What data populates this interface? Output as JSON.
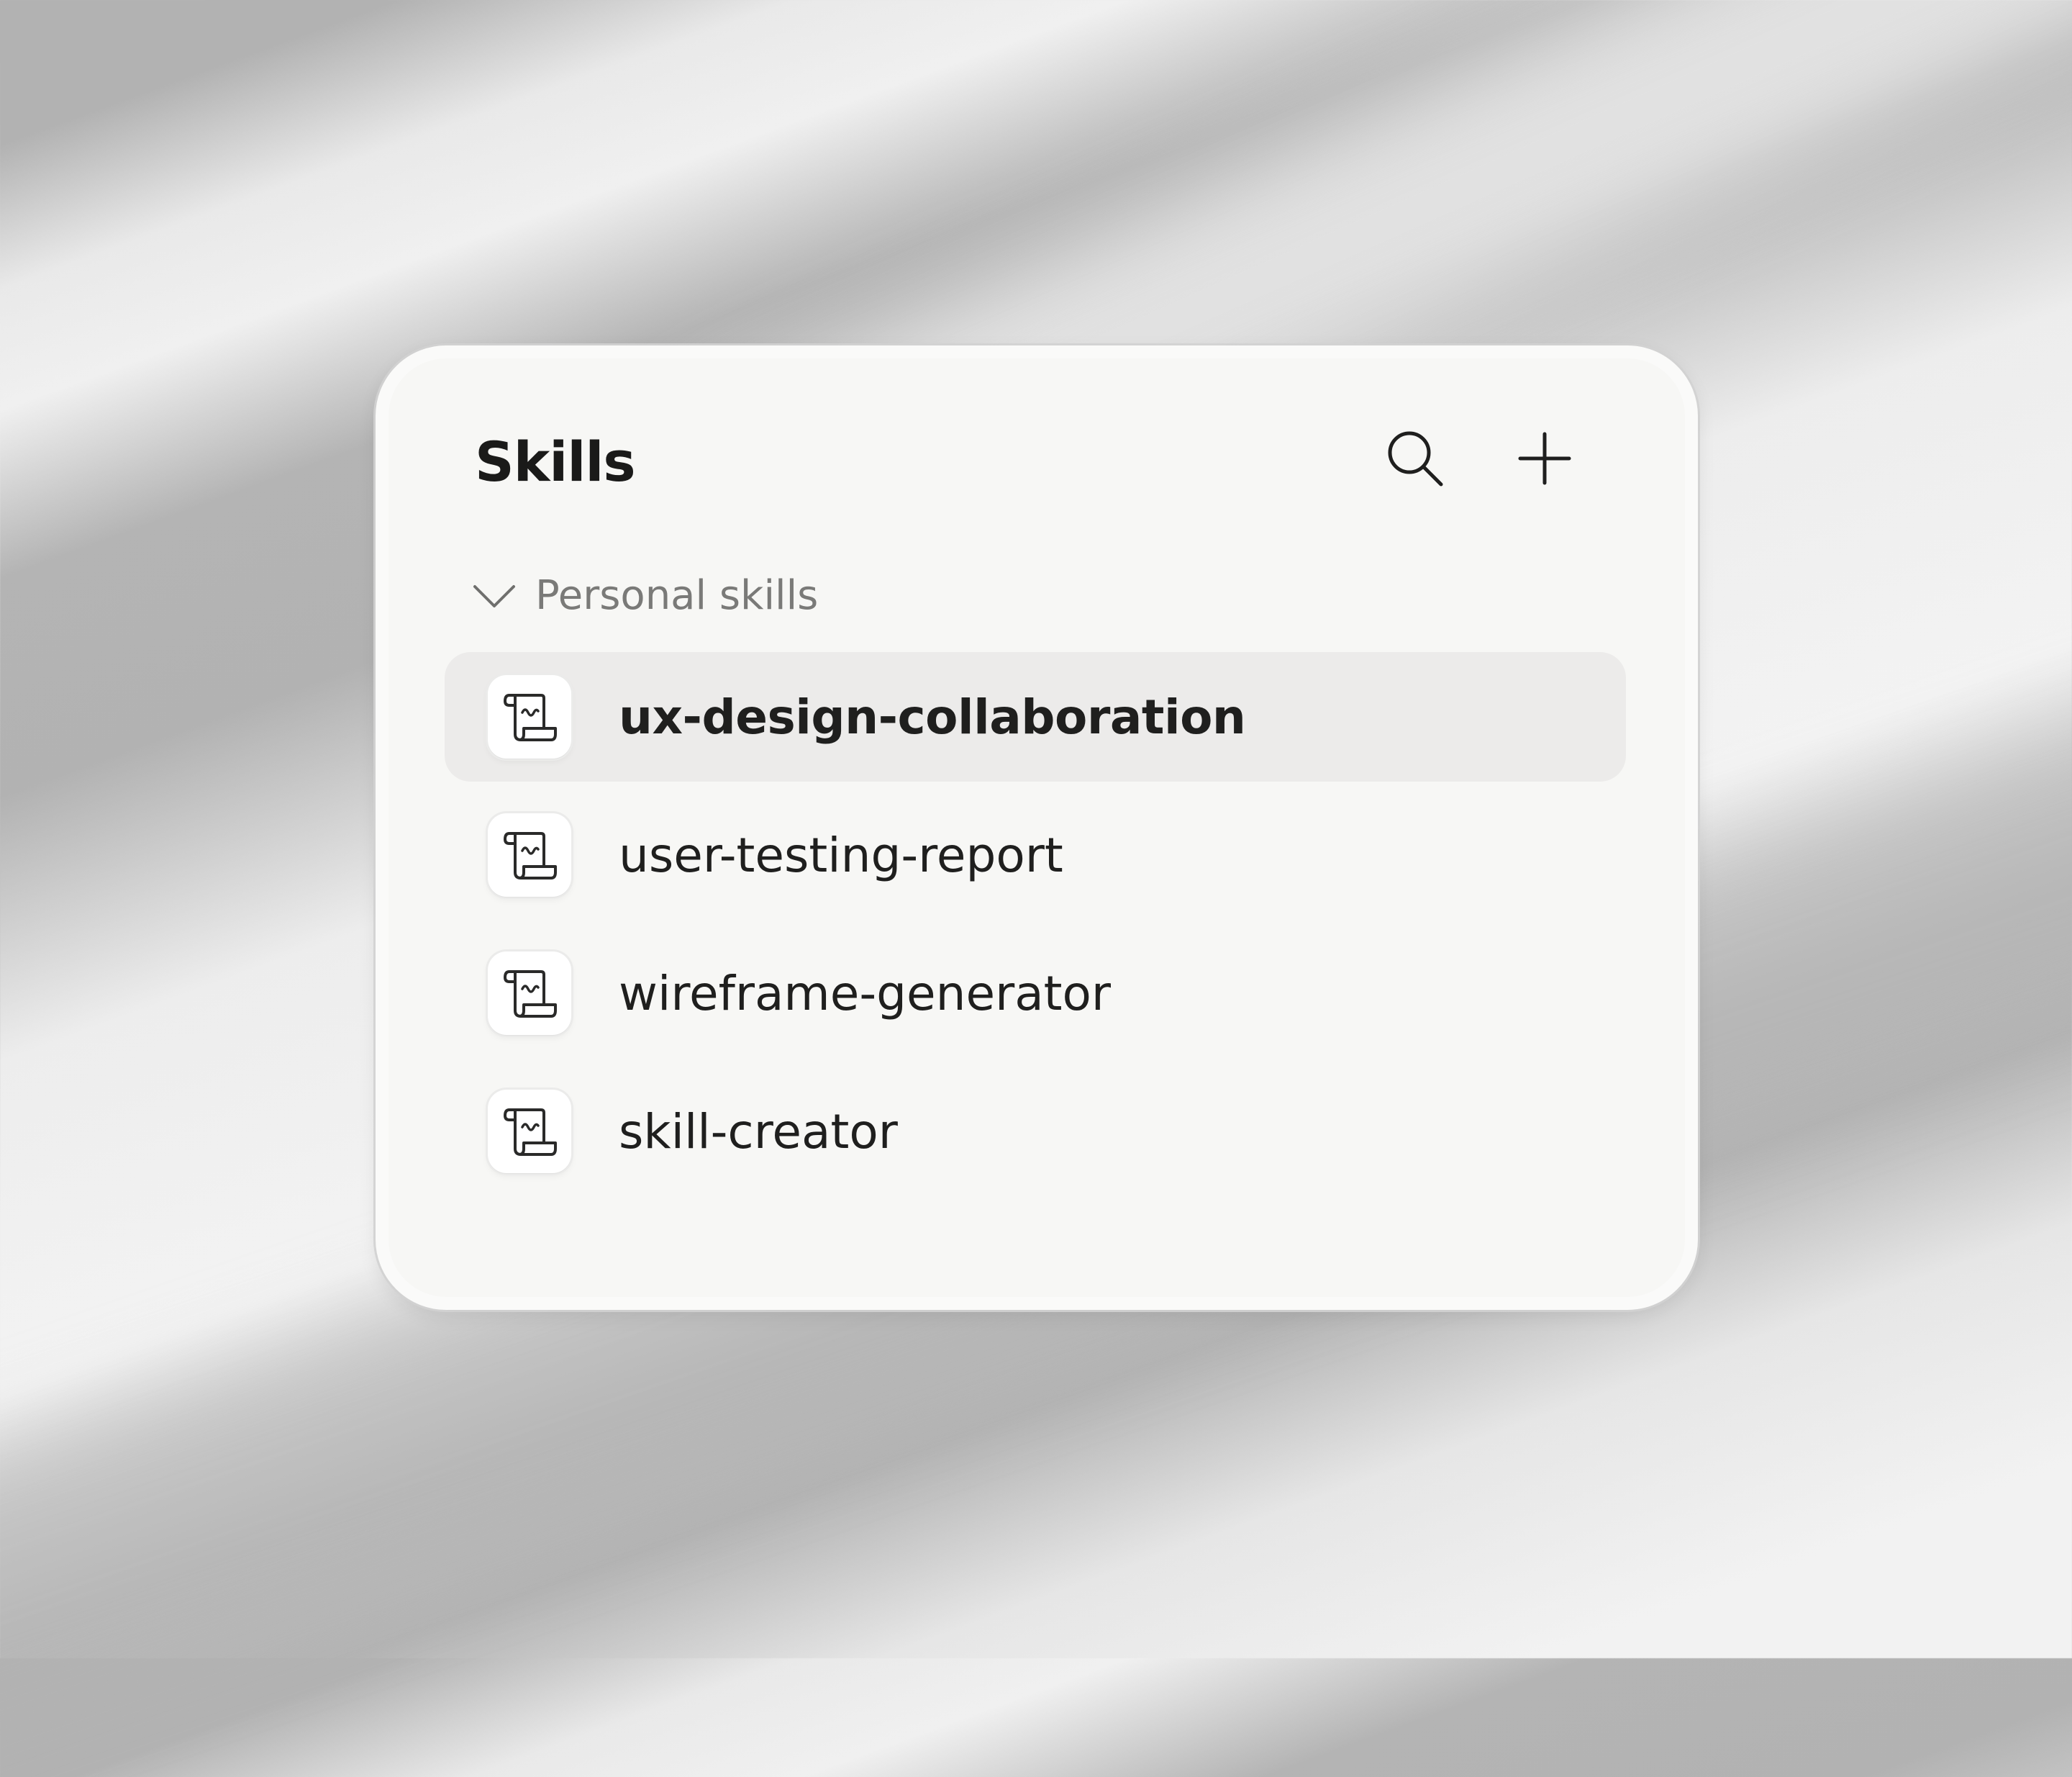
{
  "panel": {
    "title": "Skills",
    "search_icon": "search-icon",
    "add_icon": "plus-icon"
  },
  "section": {
    "label": "Personal skills",
    "expanded": true,
    "icon": "chevron-down-icon"
  },
  "skills": [
    {
      "label": "ux-design-collaboration",
      "icon": "scroll-icon",
      "selected": true
    },
    {
      "label": "user-testing-report",
      "icon": "scroll-icon",
      "selected": false
    },
    {
      "label": "wireframe-generator",
      "icon": "scroll-icon",
      "selected": false
    },
    {
      "label": "skill-creator",
      "icon": "scroll-icon",
      "selected": false
    }
  ],
  "colors": {
    "panel_bg": "#f7f7f5",
    "selected_row_bg": "#ecebea",
    "text_primary": "#1a1a19",
    "text_secondary": "#7a7a78"
  }
}
